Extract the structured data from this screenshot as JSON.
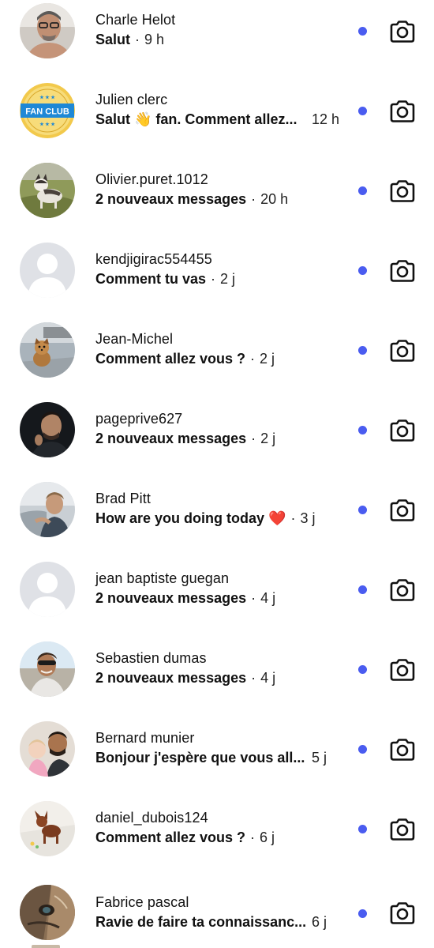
{
  "conversations": [
    {
      "name": "Charle Helot",
      "message": "Salut",
      "time": "9 h",
      "avatar": "photo-man-glasses"
    },
    {
      "name": "Julien clerc",
      "message": "Salut 👋 fan. Comment allez...",
      "time": "12 h",
      "avatar": "fan-club-badge",
      "badge_text": "FAN CLUB"
    },
    {
      "name": "Olivier.puret.1012",
      "message": "2 nouveaux messages",
      "time": "20 h",
      "avatar": "photo-husky-dog"
    },
    {
      "name": "kendjigirac554455",
      "message": "Comment tu vas",
      "time": "2 j",
      "avatar": "default-silhouette"
    },
    {
      "name": "Jean-Michel",
      "message": "Comment allez vous ?",
      "time": "2 j",
      "avatar": "photo-small-dog"
    },
    {
      "name": "pageprive627",
      "message": "2 nouveaux messages",
      "time": "2 j",
      "avatar": "photo-man-dark"
    },
    {
      "name": "Brad Pitt",
      "message": "How are you doing today ❤️",
      "time": "3 j",
      "avatar": "photo-man-car"
    },
    {
      "name": "jean baptiste guegan",
      "message": "2 nouveaux messages",
      "time": "4 j",
      "avatar": "default-silhouette"
    },
    {
      "name": "Sebastien dumas",
      "message": "2 nouveaux messages",
      "time": "4 j",
      "avatar": "photo-man-sunglasses"
    },
    {
      "name": "Bernard munier",
      "message": "Bonjour j'espère que vous all...",
      "time": "5 j",
      "avatar": "photo-man-child"
    },
    {
      "name": "daniel_dubois124",
      "message": "Comment allez vous ?",
      "time": "6 j",
      "avatar": "photo-chihuahua"
    },
    {
      "name": "Fabrice pascal",
      "message": "Ravie de faire ta connaissanc...",
      "time": "6 j",
      "avatar": "photo-dog-closeup"
    }
  ],
  "separator": "·",
  "colors": {
    "unread_dot": "#4a5cf0",
    "text": "#111111",
    "placeholder_bg": "#dfe1e6",
    "placeholder_fg": "#ffffff"
  },
  "icons": {
    "unread": "unread-dot-icon",
    "camera": "camera-icon"
  }
}
